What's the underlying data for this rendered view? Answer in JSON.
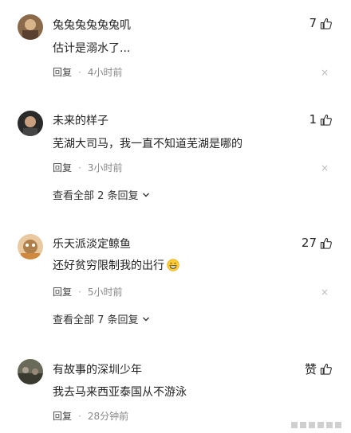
{
  "comments": [
    {
      "username": "兔兔兔兔兔兔叽",
      "likes": "7",
      "text": "估计是溺水了...",
      "reply_label": "回复",
      "time": "4小时前",
      "avatar_icon": "avatar-icon"
    },
    {
      "username": "未来的样子",
      "likes": "1",
      "text": "芜湖大司马，我一直不知道芜湖是哪的",
      "reply_label": "回复",
      "time": "3小时前",
      "expand": "查看全部 2 条回复",
      "avatar_icon": "avatar-icon"
    },
    {
      "username": "乐天派淡定鲸鱼",
      "likes": "27",
      "text": "还好贫穷限制我的出行",
      "reply_label": "回复",
      "time": "5小时前",
      "expand": "查看全部 7 条回复",
      "avatar_icon": "avatar-icon"
    },
    {
      "username": "有故事的深圳少年",
      "likes": "赞",
      "text": "我去马来西亚泰国从不游泳",
      "reply_label": "回复",
      "time": "28分钟前",
      "avatar_icon": "avatar-icon"
    }
  ],
  "close_symbol": "×",
  "colors": {
    "text": "#222222",
    "meta": "#888888"
  }
}
